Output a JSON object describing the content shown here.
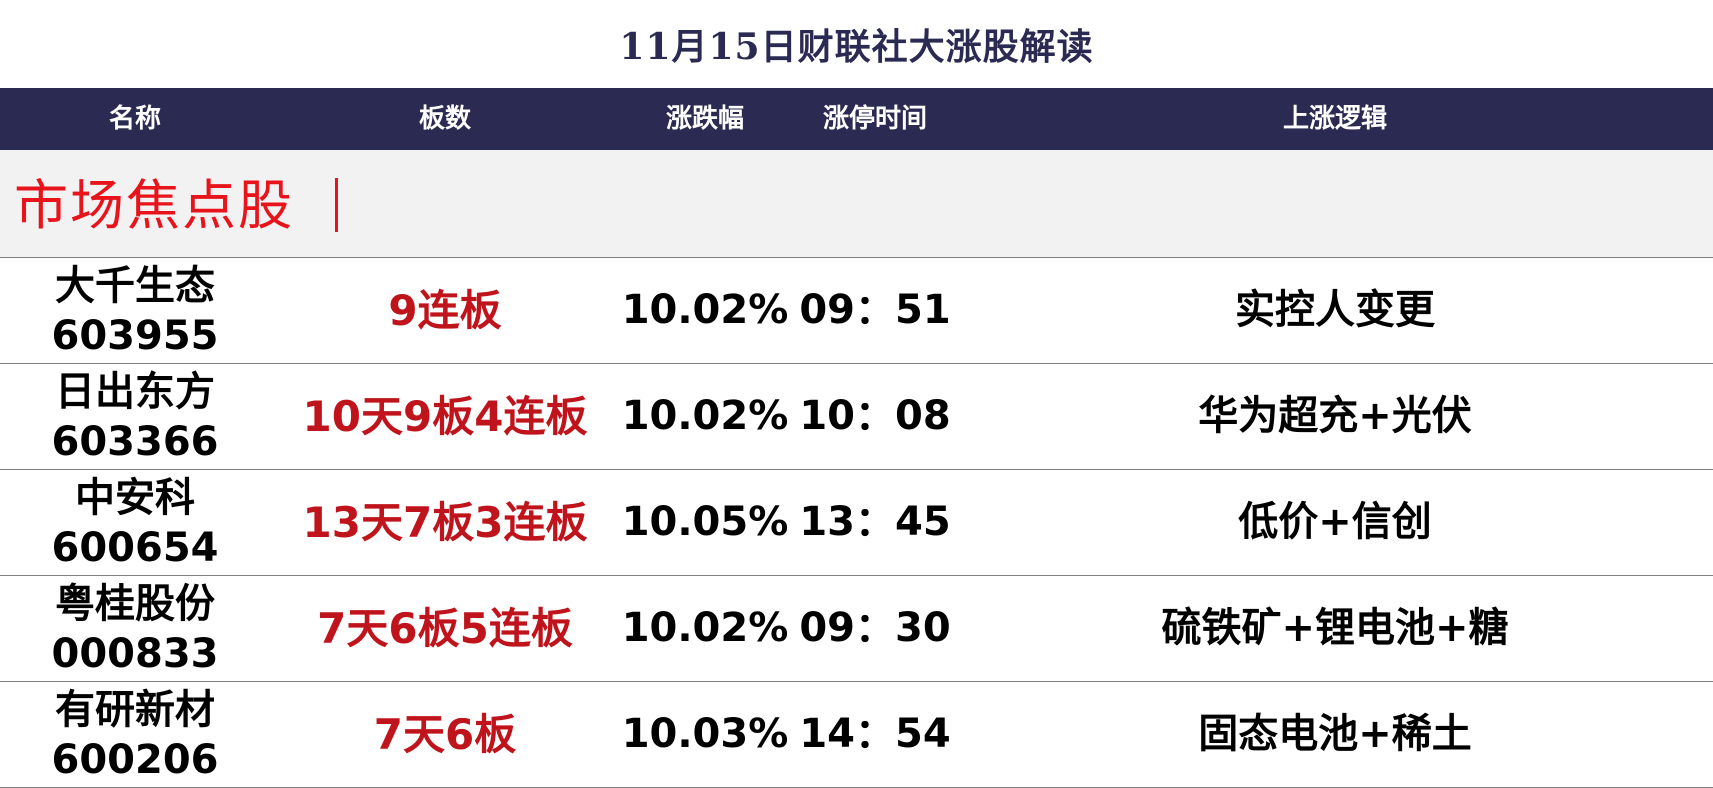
{
  "title": "11月15日财联社大涨股解读",
  "columns": {
    "name": "名称",
    "boards": "板数",
    "change": "涨跌幅",
    "limit_time": "涨停时间",
    "reason": "上涨逻辑"
  },
  "section": {
    "label": "市场焦点股"
  },
  "rows": [
    {
      "name": "大千生态",
      "code": "603955",
      "boards": "9连板",
      "change": "10.02%",
      "time": "09：51",
      "reason": "实控人变更"
    },
    {
      "name": "日出东方",
      "code": "603366",
      "boards": "10天9板4连板",
      "change": "10.02%",
      "time": "10：08",
      "reason": "华为超充+光伏"
    },
    {
      "name": "中安科",
      "code": "600654",
      "boards": "13天7板3连板",
      "change": "10.05%",
      "time": "13：45",
      "reason": "低价+信创"
    },
    {
      "name": "粤桂股份",
      "code": "000833",
      "boards": "7天6板5连板",
      "change": "10.02%",
      "time": "09：30",
      "reason": "硫铁矿+锂电池+糖"
    },
    {
      "name": "有研新材",
      "code": "600206",
      "boards": "7天6板",
      "change": "10.03%",
      "time": "14：54",
      "reason": "固态电池+稀土"
    }
  ],
  "colors": {
    "header_bg": "#2b2a52",
    "title": "#2b2a52",
    "accent_red": "#e8141c",
    "board_red": "#c0141c",
    "section_bg": "#f2f2f2"
  }
}
